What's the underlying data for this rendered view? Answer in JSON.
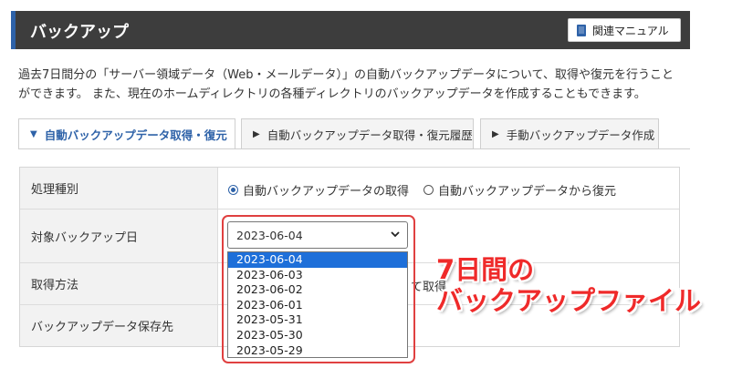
{
  "header": {
    "title": "バックアップ",
    "manual_label": "関連マニュアル"
  },
  "description": {
    "line1": "過去7日間分の「サーバー領域データ（Web・メールデータ）」の自動バックアップデータについて、取得や復元を行うこと",
    "line2": "ができます。 また、現在のホームディレクトリの各種ディレクトリのバックアップデータを作成することもできます。"
  },
  "tabs": [
    {
      "label": "自動バックアップデータ取得・復元",
      "active": true,
      "chevron": "▼"
    },
    {
      "label": "自動バックアップデータ取得・復元履歴",
      "active": false,
      "chevron": "▶"
    },
    {
      "label": "手動バックアップデータ作成",
      "active": false,
      "chevron": "▶"
    }
  ],
  "form": {
    "rows": [
      {
        "label": "処理種別"
      },
      {
        "label": "対象バックアップ日"
      },
      {
        "label": "取得方法"
      },
      {
        "label": "バックアップデータ保存先"
      }
    ],
    "process_type": {
      "options": [
        "自動バックアップデータの取得",
        "自動バックアップデータから復元"
      ],
      "selected": 0
    },
    "backup_date": {
      "value": "2023-06-04",
      "options": [
        "2023-06-04",
        "2023-06-03",
        "2023-06-02",
        "2023-06-01",
        "2023-05-31",
        "2023-05-30",
        "2023-05-29"
      ],
      "highlighted": 0
    },
    "partial_text": "て取得"
  },
  "annotation": {
    "line1": "7日間の",
    "line2": "バックアップファイル"
  },
  "colors": {
    "accent": "#2e62a8",
    "header_bg": "#3d3d3d",
    "annotation": "#ef2a2a",
    "option_highlight": "#1e6fd9"
  }
}
